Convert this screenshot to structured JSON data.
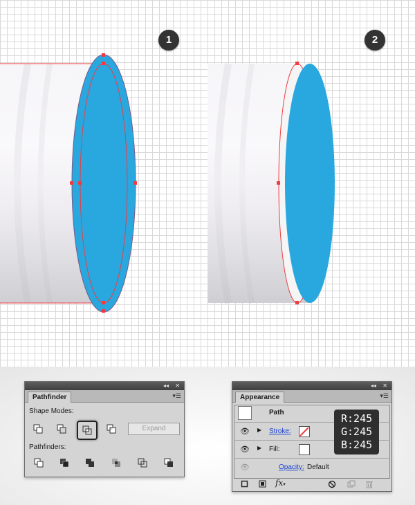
{
  "step_badges": [
    "1",
    "2"
  ],
  "colors": {
    "shape_blue": "#29a8e0",
    "anchor_red": "#ef3b42",
    "tube_light": "#f5f5f5",
    "tooltip_bg": "#2f2f2f"
  },
  "pathfinder": {
    "tab_label": "Pathfinder",
    "shape_modes_label": "Shape Modes:",
    "shape_mode_icons": [
      "unite-icon",
      "minus-front-icon",
      "intersect-icon",
      "exclude-icon"
    ],
    "expand_label": "Expand",
    "pathfinders_label": "Pathfinders:",
    "pathfinder_icons": [
      "divide-icon",
      "trim-icon",
      "merge-icon",
      "crop-icon",
      "outline-icon",
      "minus-back-icon"
    ]
  },
  "appearance": {
    "tab_label": "Appearance",
    "path_label": "Path",
    "stroke_label": "Stroke:",
    "fill_label": "Fill:",
    "opacity_label": "Opacity:",
    "opacity_value": "Default"
  },
  "tooltip": {
    "r": "R:245",
    "g": "G:245",
    "b": "B:245"
  }
}
